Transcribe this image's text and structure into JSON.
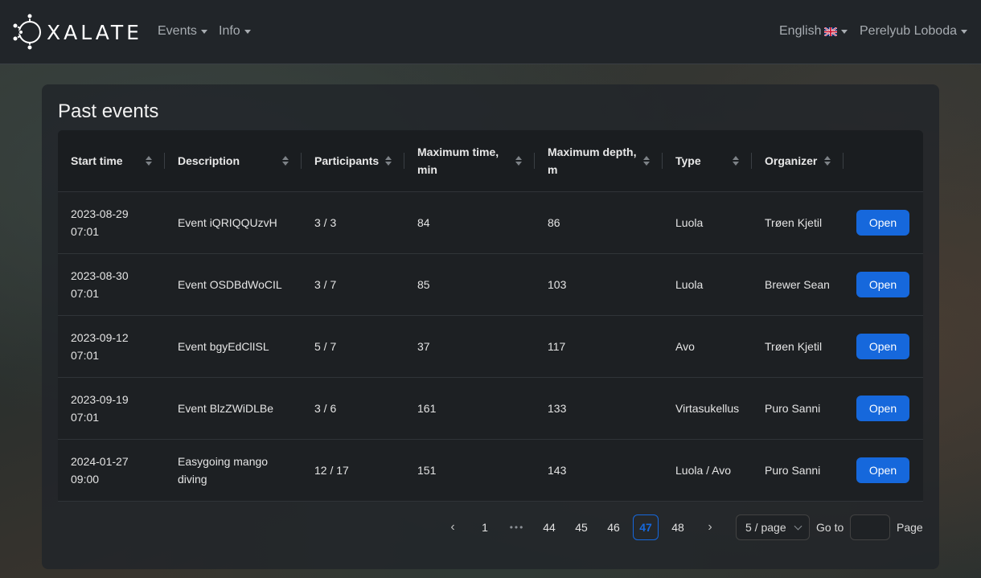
{
  "navbar": {
    "brand": "XALATE",
    "menu_events": "Events",
    "menu_info": "Info",
    "language": "English",
    "language_icon": "uk-flag-icon",
    "user": "Perelyub Loboda"
  },
  "card": {
    "title": "Past events"
  },
  "table": {
    "columns": [
      "Start time",
      "Description",
      "Participants",
      "Maximum time, min",
      "Maximum depth, m",
      "Type",
      "Organizer"
    ],
    "rows": [
      {
        "start": "2023-08-29 07:01",
        "description": "Event iQRIQQUzvH",
        "participants": "3 / 3",
        "max_time": "84",
        "max_depth": "86",
        "type": "Luola",
        "organizer": "Trøen Kjetil",
        "action": "Open"
      },
      {
        "start": "2023-08-30 07:01",
        "description": "Event OSDBdWoCIL",
        "participants": "3 / 7",
        "max_time": "85",
        "max_depth": "103",
        "type": "Luola",
        "organizer": "Brewer Sean",
        "action": "Open"
      },
      {
        "start": "2023-09-12 07:01",
        "description": "Event bgyEdClISL",
        "participants": "5 / 7",
        "max_time": "37",
        "max_depth": "117",
        "type": "Avo",
        "organizer": "Trøen Kjetil",
        "action": "Open"
      },
      {
        "start": "2023-09-19 07:01",
        "description": "Event BlzZWiDLBe",
        "participants": "3 / 6",
        "max_time": "161",
        "max_depth": "133",
        "type": "Virtasukellus",
        "organizer": "Puro Sanni",
        "action": "Open"
      },
      {
        "start": "2024-01-27 09:00",
        "description": "Easygoing mango diving",
        "participants": "12 / 17",
        "max_time": "151",
        "max_depth": "143",
        "type": "Luola / Avo",
        "organizer": "Puro Sanni",
        "action": "Open"
      }
    ]
  },
  "pagination": {
    "prev_icon": "chevron-left-icon",
    "next_icon": "chevron-right-icon",
    "pages": [
      "1",
      "44",
      "45",
      "46",
      "47",
      "48"
    ],
    "ellipsis": "•••",
    "current": "47",
    "page_size": "5 / page",
    "goto_label": "Go to",
    "goto_value": "",
    "page_label": "Page"
  },
  "colors": {
    "navbar_bg": "#212529",
    "primary": "#1668dc",
    "card_bg": "#212529"
  }
}
